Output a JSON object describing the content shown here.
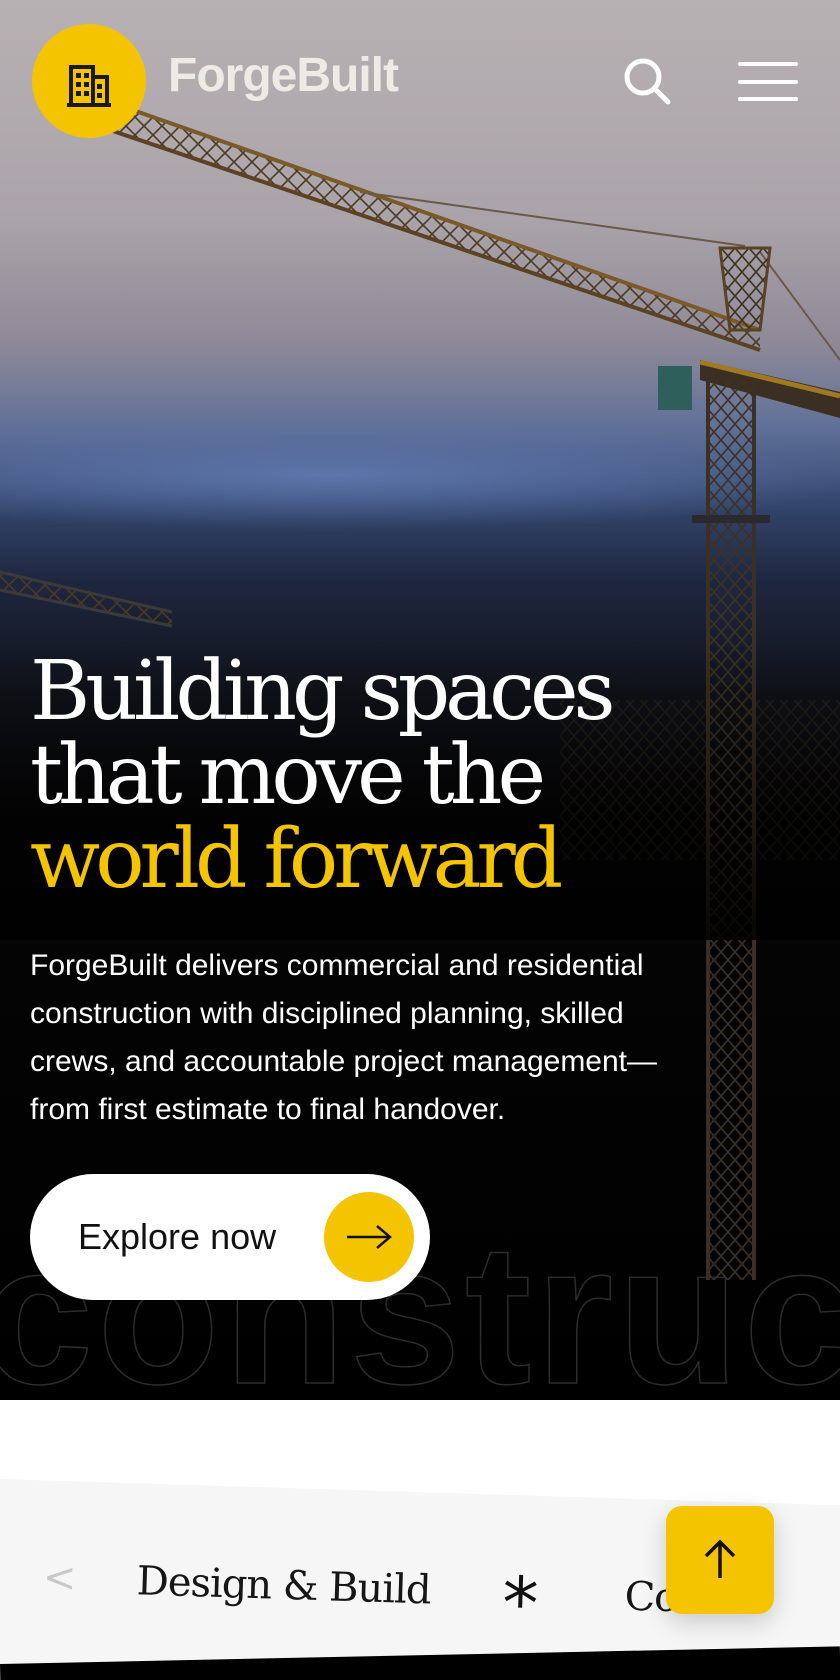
{
  "header": {
    "brand": "ForgeBuilt",
    "logo_icon": "building-icon",
    "search_icon": "search-icon",
    "menu_icon": "hamburger-menu-icon"
  },
  "hero": {
    "headline_line1": "Building spaces",
    "headline_line2": "that move the",
    "headline_accent": "world forward",
    "lede": "ForgeBuilt delivers commercial and residential construction with disciplined planning, skilled crews, and accountable project management—from first estimate to final handover.",
    "cta_label": "Explore now",
    "cta_icon": "arrow-right-icon",
    "background_word": "construct"
  },
  "ticker": {
    "items": [
      "Design & Build",
      "Co"
    ],
    "separator_icon": "asterisk-icon"
  },
  "back_to_top": {
    "icon": "arrow-up-icon"
  },
  "colors": {
    "accent": "#f5c400",
    "hero_dark": "#000000",
    "text_light": "#ffffff",
    "ticker_bg": "#f6f6f6"
  }
}
